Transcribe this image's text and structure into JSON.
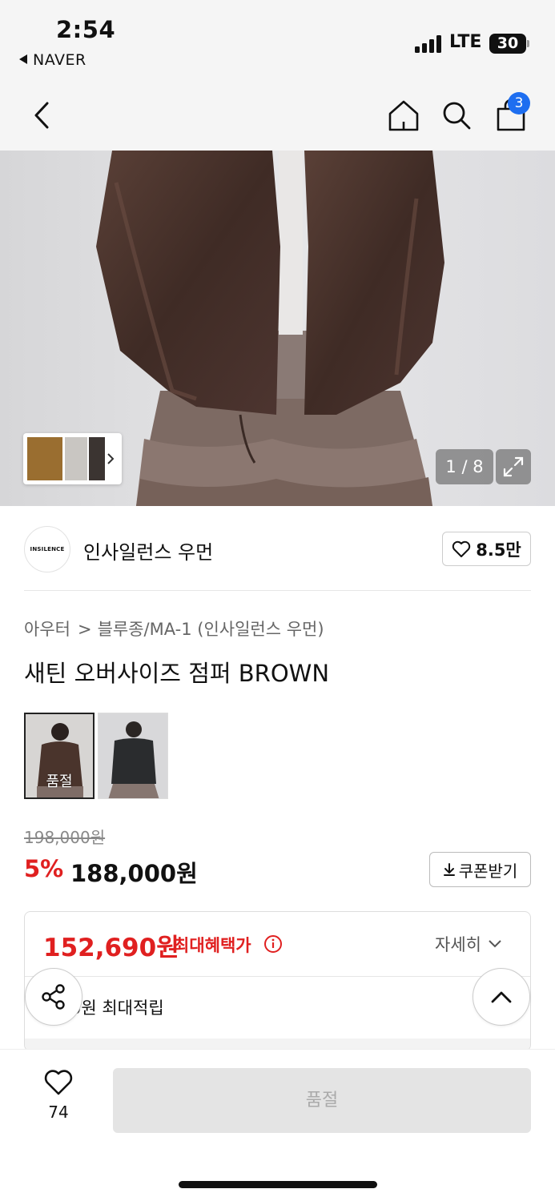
{
  "status_bar": {
    "time": "2:54",
    "back_app": "NAVER",
    "network": "LTE",
    "battery": "30"
  },
  "nav": {
    "cart_badge": "3",
    "icons": [
      "back-chevron-icon",
      "home-icon",
      "search-icon",
      "shopping-bag-icon"
    ]
  },
  "gallery": {
    "counter": "1 / 8"
  },
  "brand": {
    "logo_text": "INSILENCE",
    "name": "인사일런스 우먼",
    "likes": "8.5만"
  },
  "product": {
    "breadcrumb": [
      "아우터",
      "블루종/MA-1 (인사일런스 우먼)"
    ],
    "title": "새틴 오버사이즈 점퍼 BROWN",
    "swatch_soldout_label": "품절",
    "original_price": "198,000원",
    "discount_rate": "5%",
    "sale_price": "188,000원",
    "coupon_label": "쿠폰받기"
  },
  "benefit": {
    "max_price": "152,690원",
    "max_label": "최대혜택가",
    "detail_label": "자세히",
    "points_text": "0원 최대적립"
  },
  "bottom": {
    "wish_count": "74",
    "buy_label": "품절"
  },
  "colors": {
    "accent_red": "#e02020",
    "badge_blue": "#1e6ef0",
    "jacket_brown": "#4a342c"
  }
}
